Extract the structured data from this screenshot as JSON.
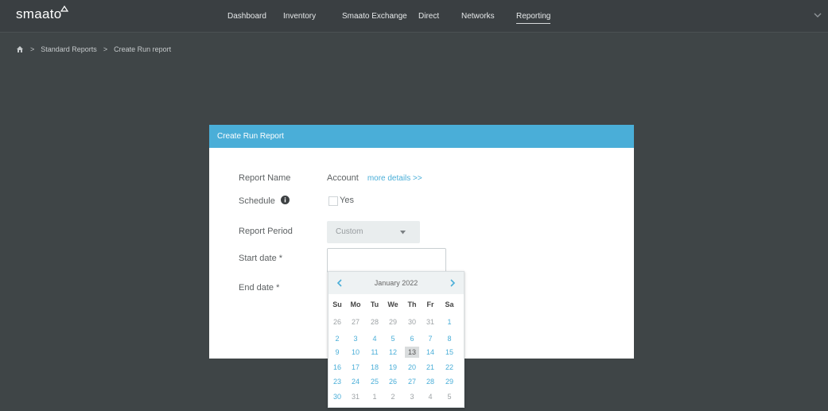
{
  "brand": {
    "name": "smaato"
  },
  "nav": {
    "items": [
      {
        "label": "Dashboard"
      },
      {
        "label": "Inventory"
      },
      {
        "label": "Smaato Exchange"
      },
      {
        "label": "Direct"
      },
      {
        "label": "Networks"
      },
      {
        "label": "Reporting",
        "active": true
      }
    ]
  },
  "breadcrumb": {
    "items": [
      {
        "label": "Standard Reports"
      },
      {
        "label": "Create Run report"
      }
    ]
  },
  "panel": {
    "title": "Create Run Report",
    "report_name_label": "Report Name",
    "report_name_value": "Account",
    "more_details": "more details >>",
    "schedule_label": "Schedule",
    "schedule_option": "Yes",
    "report_period_label": "Report Period",
    "report_period_value": "Custom",
    "start_date_label": "Start date *",
    "end_date_label": "End date *",
    "start_date_value": ""
  },
  "datepicker": {
    "month_label": "January 2022",
    "weekdays": [
      "Su",
      "Mo",
      "Tu",
      "We",
      "Th",
      "Fr",
      "Sa"
    ],
    "weeks": [
      [
        "26",
        "27",
        "28",
        "29",
        "30",
        "31",
        "1"
      ],
      [
        "2",
        "3",
        "4",
        "5",
        "6",
        "7",
        "8"
      ],
      [
        "9",
        "10",
        "11",
        "12",
        "13",
        "14",
        "15"
      ],
      [
        "16",
        "17",
        "18",
        "19",
        "20",
        "21",
        "22"
      ],
      [
        "23",
        "24",
        "25",
        "26",
        "27",
        "28",
        "29"
      ],
      [
        "30",
        "31",
        "1",
        "2",
        "3",
        "4",
        "5"
      ]
    ],
    "highlighted_day": "13"
  },
  "colors": {
    "accent": "#4aaed8",
    "topbar": "#3a3f42",
    "background": "#3f4547"
  }
}
